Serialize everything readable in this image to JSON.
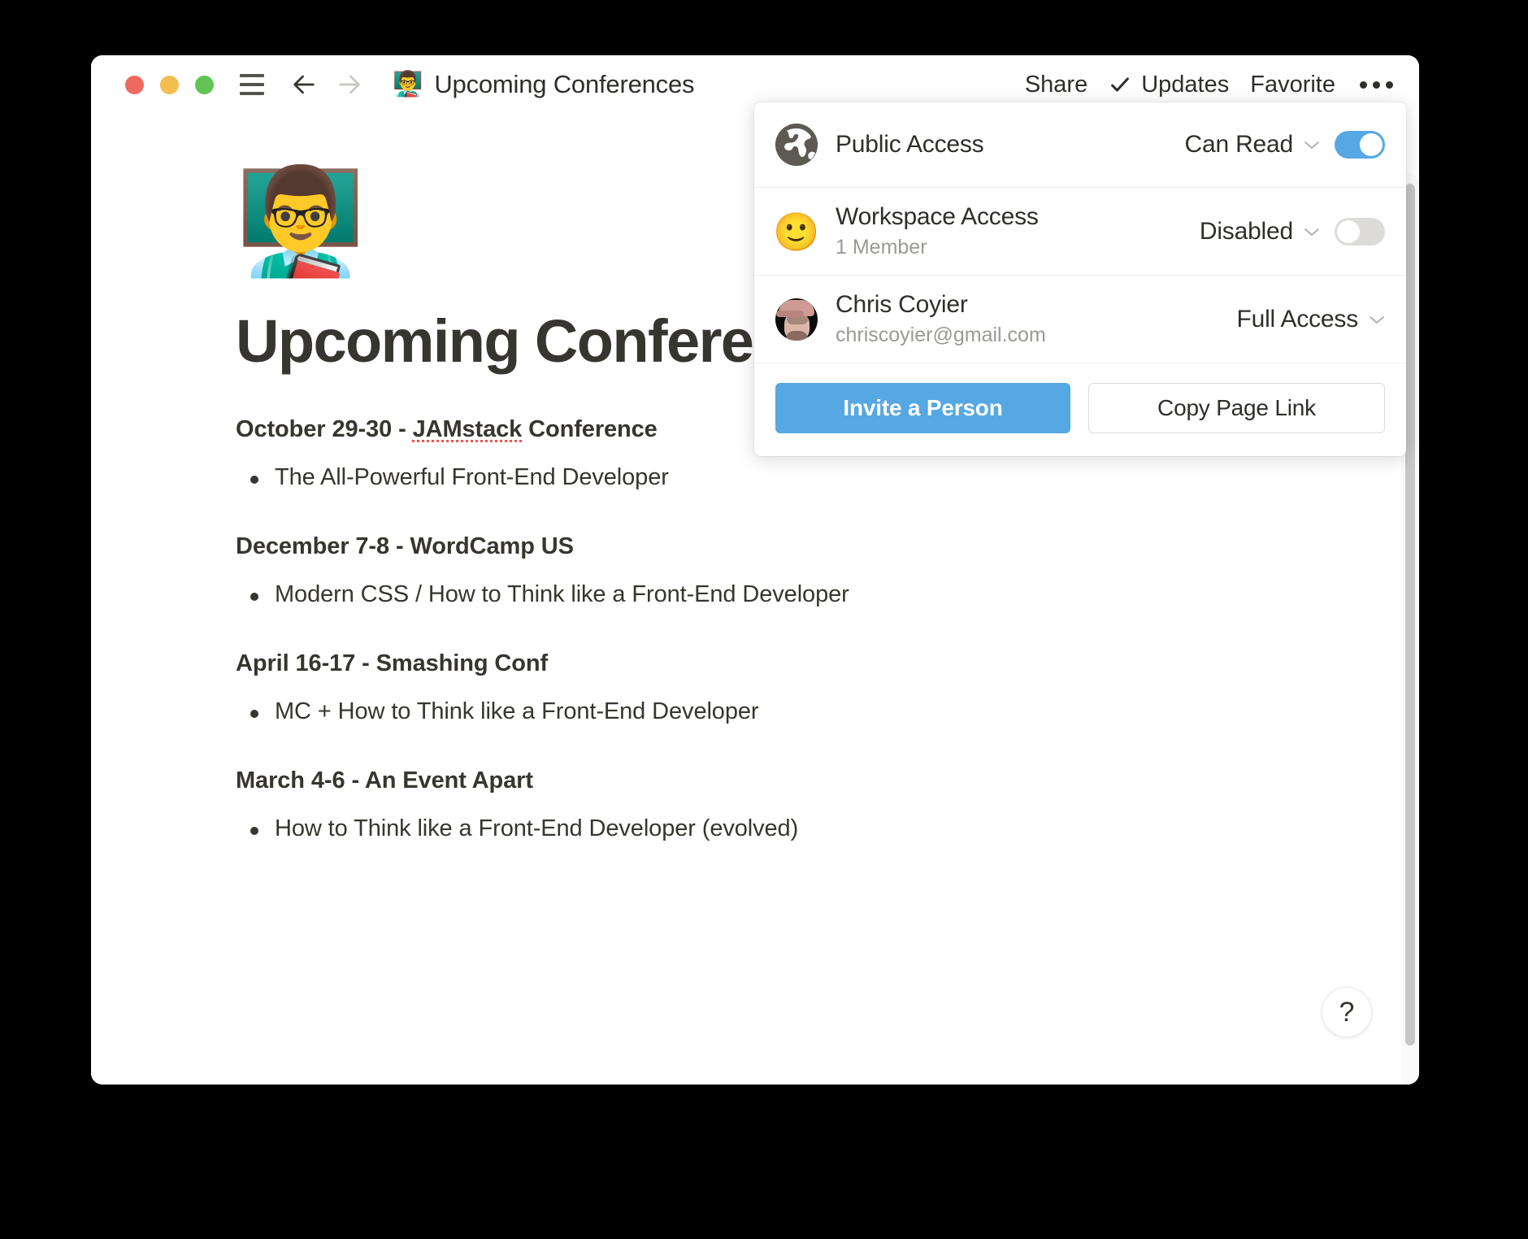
{
  "window": {
    "traffic_lights": {
      "close": "close",
      "minimize": "minimize",
      "zoom": "zoom",
      "close_color": "#ee6a5f",
      "minimize_color": "#f5bd4f",
      "zoom_color": "#61c454"
    }
  },
  "titlebar": {
    "menu_icon": "hamburger-menu-icon",
    "back_icon": "back-arrow-icon",
    "forward_icon": "forward-arrow-icon",
    "doc_emoji": "👨‍🏫",
    "doc_title": "Upcoming Conferences",
    "share_label": "Share",
    "updates_label": "Updates",
    "updates_check_icon": "checkmark-icon",
    "favorite_label": "Favorite",
    "more_icon": "ellipsis-icon"
  },
  "share_popover": {
    "rows": [
      {
        "icon": "globe-icon",
        "title": "Public Access",
        "subtitle": "",
        "permission": "Can Read",
        "toggle_state": "on",
        "toggle_color": "#55a8e2"
      },
      {
        "icon": "smiley-face-icon",
        "icon_glyph": "🙂",
        "title": "Workspace Access",
        "subtitle": "1 Member",
        "permission": "Disabled",
        "toggle_state": "off",
        "toggle_color": "#dcdbd8"
      },
      {
        "icon": "user-avatar-photo",
        "title": "Chris Coyier",
        "subtitle": "chriscoyier@gmail.com",
        "permission": "Full Access",
        "toggle_state": "none"
      }
    ],
    "invite_button": "Invite a Person",
    "copy_link_button": "Copy Page Link",
    "accent_color": "#55a8e2"
  },
  "document": {
    "emoji": "👨‍🏫",
    "heading": "Upcoming Conferences",
    "conferences": [
      {
        "date_prefix": "October 29-30 - ",
        "misspelled_word": "JAMstack",
        "date_suffix": " Conference",
        "talk": "The All-Powerful Front-End Developer"
      },
      {
        "date_prefix": "December 7-8 - WordCamp US",
        "misspelled_word": "",
        "date_suffix": "",
        "talk": "Modern CSS / How to Think like a Front-End Developer"
      },
      {
        "date_prefix": "April 16-17 - Smashing Conf",
        "misspelled_word": "",
        "date_suffix": "",
        "talk": "MC + How to Think like a Front-End Developer"
      },
      {
        "date_prefix": "March 4-6 - An Event Apart",
        "misspelled_word": "",
        "date_suffix": "",
        "talk": "How to Think like a Front-End Developer (evolved)"
      }
    ]
  },
  "help": {
    "label": "?",
    "icon": "question-mark-icon"
  },
  "scrollbar": {
    "name": "vertical-scrollbar"
  }
}
